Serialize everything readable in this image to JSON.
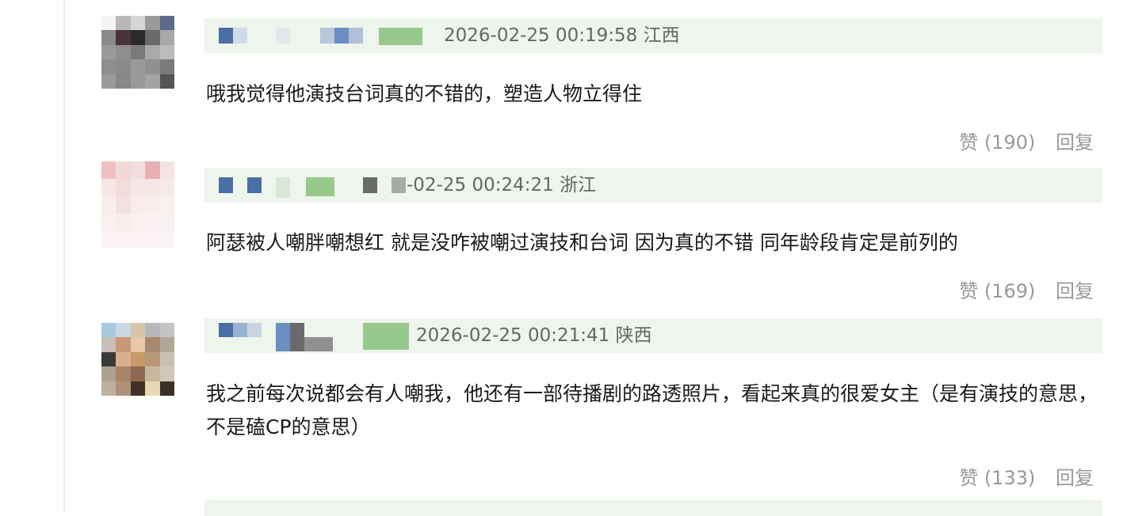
{
  "comments": [
    {
      "time": "2026-02-25 00:19:58",
      "location": "江西",
      "text": "哦我觉得他演技台词真的不错的，塑造人物立得住",
      "likes_label": "赞 (190)",
      "reply_label": "回复"
    },
    {
      "time": "-02-25 00:24:21",
      "location": "浙江",
      "text": "阿瑟被人嘲胖嘲想红 就是没咋被嘲过演技和台词 因为真的不错 同年龄段肯定是前列的",
      "likes_label": "赞 (169)",
      "reply_label": "回复"
    },
    {
      "time": "2026-02-25 00:21:41",
      "location": "陕西",
      "text": "我之前每次说都会有人嘲我，他还有一部待播剧的路透照片，看起来真的很爱女主（是有演技的意思，不是磕CP的意思）",
      "likes_label": "赞 (133)",
      "reply_label": "回复"
    }
  ]
}
